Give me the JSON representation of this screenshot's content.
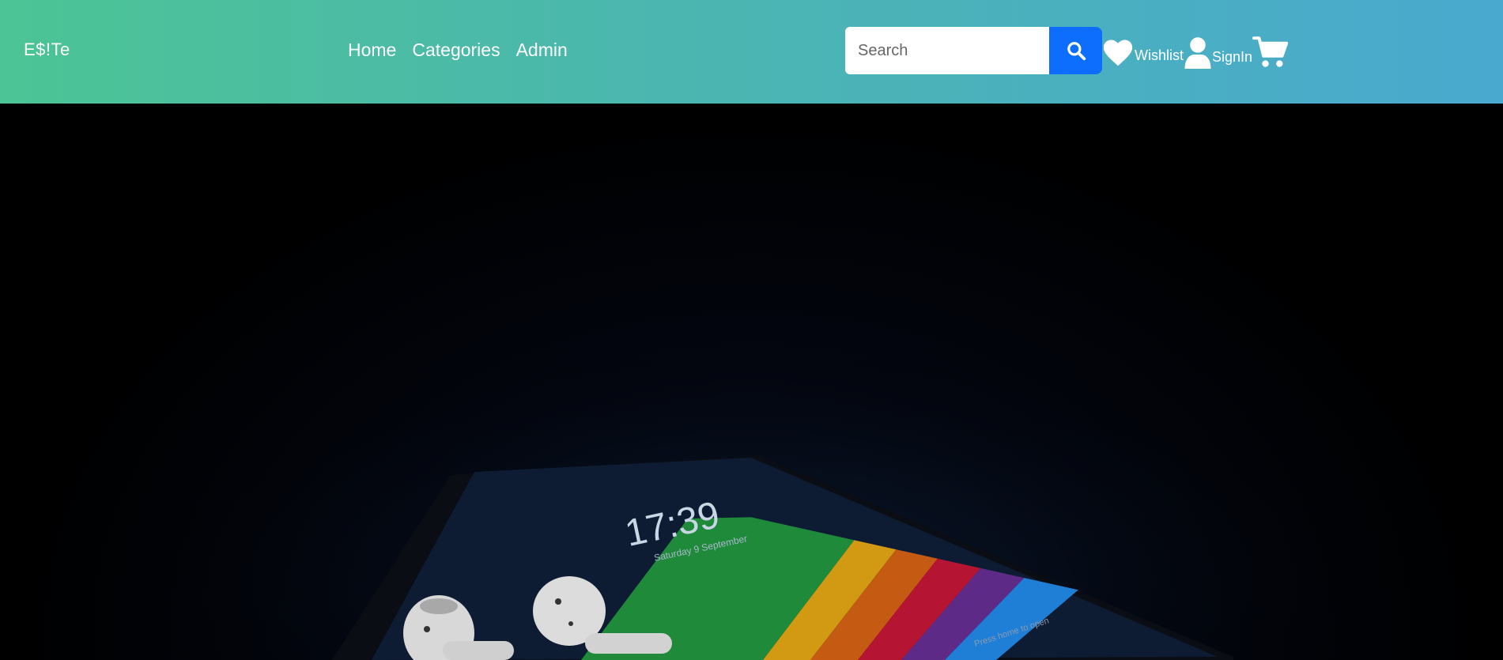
{
  "brand": {
    "name": "E$!Te"
  },
  "nav": {
    "items": [
      {
        "label": "Home"
      },
      {
        "label": "Categories"
      },
      {
        "label": "Admin"
      }
    ]
  },
  "search": {
    "placeholder": "Search",
    "value": "",
    "button_icon": "search-icon"
  },
  "actions": {
    "wishlist": {
      "label": "Wishlist",
      "icon": "heart-icon"
    },
    "signin": {
      "label": "SignIn",
      "icon": "user-icon"
    },
    "cart": {
      "icon": "cart-icon"
    }
  },
  "hero": {
    "image_subject": "smartphone-with-earbuds",
    "clock": "17:39",
    "date": "Saturday 9 September",
    "unlock_hint": "Press home to open"
  },
  "colors": {
    "navbar_gradient_start": "#4cc495",
    "navbar_gradient_end": "#4aa9cf",
    "search_button": "#0d6efd",
    "hero_background": "#000000"
  }
}
